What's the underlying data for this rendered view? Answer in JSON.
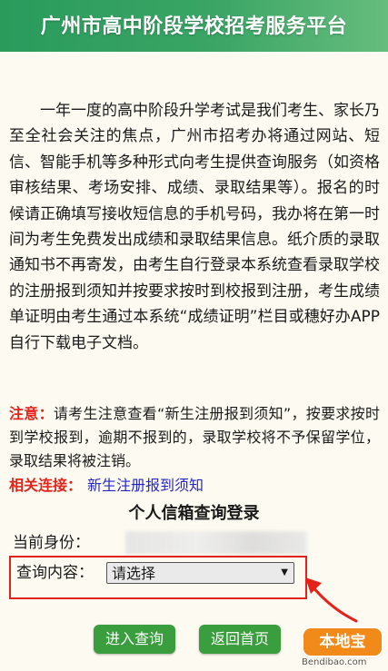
{
  "header": {
    "title": "广州市高中阶段学校招考服务平台",
    "colors": {
      "start": "#2a9b5c",
      "end": "#66bd7d"
    }
  },
  "intro": {
    "text": "一年一度的高中阶段升学考试是我们考生、家长乃至全社会关注的焦点，广州市招考办将通过网站、短信、智能手机等多种形式向考生提供查询服务（如资格审核结果、考场安排、成绩、录取结果等）。报名的时候请正确填写接收短信息的手机号码，我办将在第一时间为考生免费发出成绩和录取结果信息。纸介质的录取通知书不再寄发，由考生自行登录本系统查看录取学校的注册报到须知并按要求按时到校报到注册，考生成绩单证明由考生通过本系统“成绩证明”栏目或穗好办APP自行下载电子文档。"
  },
  "notice": {
    "label": "注意：",
    "text": "请考生注意查看“新生注册报到须知”，按要求按时到学校报到，逾期不报到的，录取学校将不予保留学位，录取结果将被注销。"
  },
  "related": {
    "label": "相关连接：",
    "link_text": "新生注册报到须知"
  },
  "login": {
    "title": "个人信箱查询登录",
    "identity_label": "当前身份：",
    "query_label": "查询内容：",
    "select_value": "请选择",
    "select_arrow_icon": "triangle-down-icon"
  },
  "buttons": {
    "query": "进入查询",
    "home": "返回首页",
    "color": "#3a9d3e"
  },
  "watermark": {
    "logo_text": "本地宝",
    "url": "Bendibao.com"
  },
  "accent_red": "#e3231a",
  "link_blue": "#2626c8"
}
